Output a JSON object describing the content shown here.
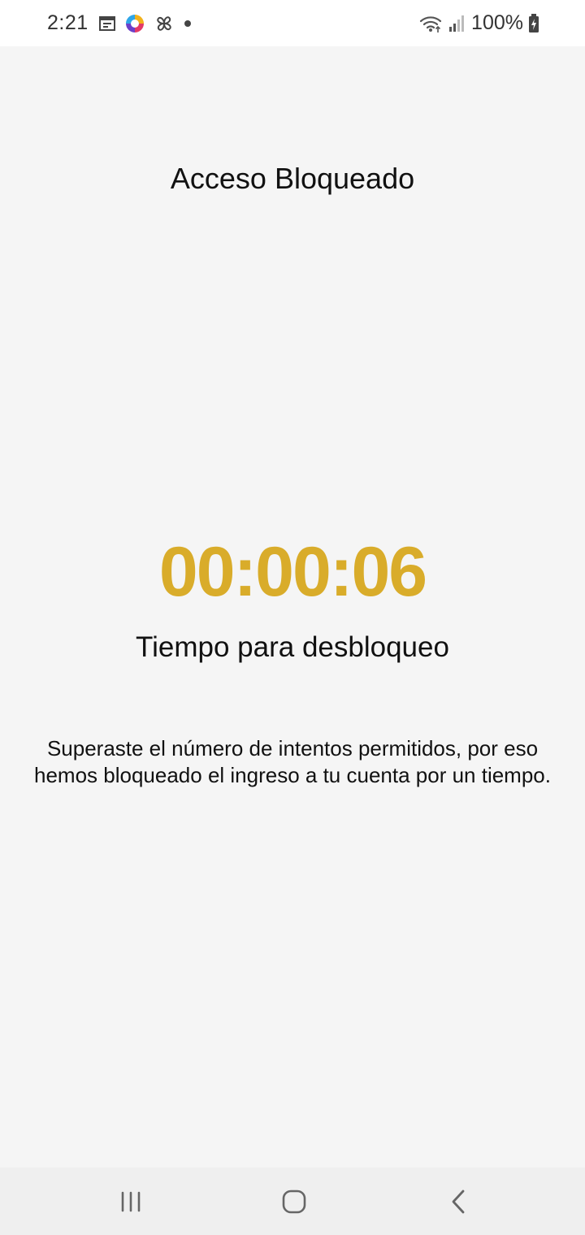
{
  "status_bar": {
    "time": "2:21",
    "battery": "100%",
    "left_icons": [
      "calendar-icon",
      "app-icon",
      "pinwheel-icon",
      "dot-icon"
    ],
    "right_icons": [
      "wifi-icon",
      "signal-icon",
      "battery-charging-icon"
    ]
  },
  "screen": {
    "title": "Acceso Bloqueado",
    "countdown": "00:00:06",
    "countdown_label": "Tiempo para desbloqueo",
    "message": "Superaste el número de intentos permitidos, por eso hemos bloqueado el ingreso a tu cuenta por un tiempo."
  },
  "colors": {
    "countdown": "#d9ac2a",
    "background": "#f5f5f5",
    "nav_bar": "#efefef"
  },
  "navigation": {
    "buttons": [
      "recent-apps",
      "home",
      "back"
    ]
  }
}
